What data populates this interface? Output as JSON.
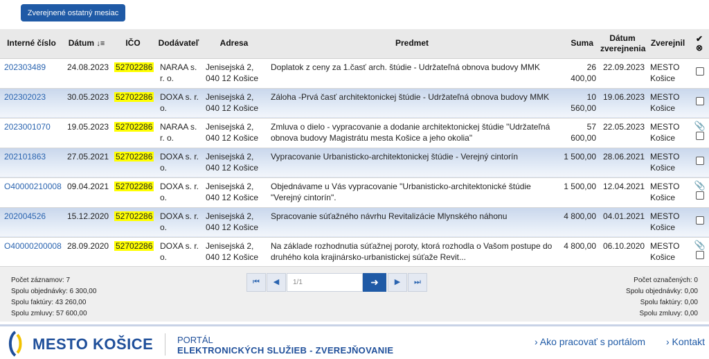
{
  "toolbar": {
    "last_month_button": "Zverejnené ostatný mesiac"
  },
  "table": {
    "headers": {
      "internal_number": "Interné číslo",
      "date": "Dátum",
      "ico": "IČO",
      "supplier": "Dodávateľ",
      "address": "Adresa",
      "subject": "Predmet",
      "amount": "Suma",
      "published_date": "Dátum zverejnenia",
      "published_by": "Zverejnil"
    },
    "rows": [
      {
        "id": "202303489",
        "date": "24.08.2023",
        "ico": "52702286",
        "supplier": "NARAA s. r. o.",
        "address": "Jenisejská 2, 040 12 Košice",
        "subject": "Doplatok z ceny za 1.časť arch. štúdie - Udržateľná obnova budovy MMK",
        "amount": "26 400,00",
        "published": "22.09.2023",
        "by": "MESTO Košice",
        "attachment": false
      },
      {
        "id": "202302023",
        "date": "30.05.2023",
        "ico": "52702286",
        "supplier": "DOXA s. r. o.",
        "address": "Jenisejská 2, 040 12 Košice",
        "subject": "Záloha -Prvá časť architektonickej štúdie - Udržateľná obnova budovy MMK",
        "amount": "10 560,00",
        "published": "19.06.2023",
        "by": "MESTO Košice",
        "attachment": false
      },
      {
        "id": "2023001070",
        "date": "19.05.2023",
        "ico": "52702286",
        "supplier": "NARAA s. r. o.",
        "address": "Jenisejská 2, 040 12 Košice",
        "subject": "Zmluva o dielo - vypracovanie a dodanie architektonickej štúdie \"Udržateľná obnova budovy Magistrátu mesta Košice a jeho okolia\"",
        "amount": "57 600,00",
        "published": "22.05.2023",
        "by": "MESTO Košice",
        "attachment": true
      },
      {
        "id": "202101863",
        "date": "27.05.2021",
        "ico": "52702286",
        "supplier": "DOXA s. r. o.",
        "address": "Jenisejská 2, 040 12 Košice",
        "subject": "Vypracovanie Urbanisticko-architektonickej štúdie - Verejný cintorín",
        "amount": "1 500,00",
        "published": "28.06.2021",
        "by": "MESTO Košice",
        "attachment": false
      },
      {
        "id": "O40000210008",
        "date": "09.04.2021",
        "ico": "52702286",
        "supplier": "DOXA s. r. o.",
        "address": "Jenisejská 2, 040 12 Košice",
        "subject": "Objednávame u Vás vypracovanie \"Urbanisticko-architektonické štúdie \"Verejný cintorín\".",
        "amount": "1 500,00",
        "published": "12.04.2021",
        "by": "MESTO Košice",
        "attachment": true
      },
      {
        "id": "202004526",
        "date": "15.12.2020",
        "ico": "52702286",
        "supplier": "DOXA s. r. o.",
        "address": "Jenisejská 2, 040 12 Košice",
        "subject": "Spracovanie súťažného návrhu Revitalizácie Mlynského náhonu",
        "amount": "4 800,00",
        "published": "04.01.2021",
        "by": "MESTO Košice",
        "attachment": false
      },
      {
        "id": "O40000200008",
        "date": "28.09.2020",
        "ico": "52702286",
        "supplier": "DOXA s. r. o.",
        "address": "Jenisejská 2, 040 12 Košice",
        "subject": "Na základe rozhodnutia súťažnej poroty, ktorá rozhodla o Vašom postupe do druhého kola krajinársko-urbanistickej súťaže Revit...",
        "amount": "4 800,00",
        "published": "06.10.2020",
        "by": "MESTO Košice",
        "attachment": true
      }
    ]
  },
  "summary_left": {
    "records": "Počet záznamov: 7",
    "orders": "Spolu objednávky: 6 300,00",
    "invoices": "Spolu faktúry: 43 260,00",
    "contracts": "Spolu zmluvy: 57 600,00"
  },
  "summary_right": {
    "selected": "Počet označených: 0",
    "orders": "Spolu objednávky: 0,00",
    "invoices": "Spolu faktúry: 0,00",
    "contracts": "Spolu zmluvy: 0,00"
  },
  "pager": {
    "placeholder": "1/1"
  },
  "footer": {
    "brand": "MESTO KOŠICE",
    "portal_line1": "PORTÁL",
    "portal_line2": "ELEKTRONICKÝCH SLUŽIEB - ZVEREJŇOVANIE",
    "link_help": "› Ako pracovať s portálom",
    "link_contact": "› Kontakt"
  },
  "colors": {
    "accent": "#1f5aa6",
    "highlight": "#ffff00",
    "link": "#2a64b0"
  }
}
